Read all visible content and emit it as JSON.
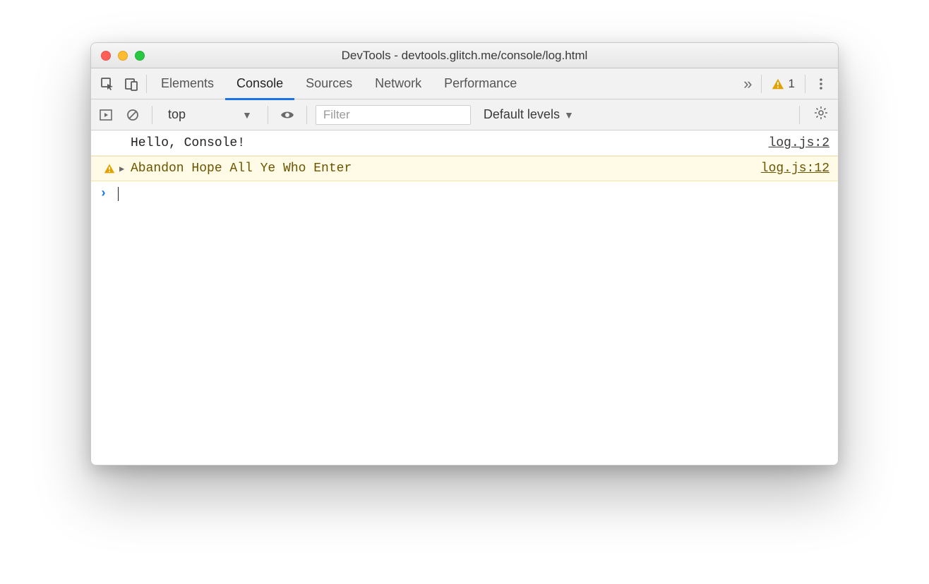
{
  "window": {
    "title": "DevTools - devtools.glitch.me/console/log.html"
  },
  "tabs": {
    "items": [
      "Elements",
      "Console",
      "Sources",
      "Network",
      "Performance"
    ],
    "active_index": 1,
    "overflow_glyph": "»",
    "warning_count": "1"
  },
  "toolbar": {
    "context_label": "top",
    "filter_placeholder": "Filter",
    "levels_label": "Default levels"
  },
  "console": {
    "rows": [
      {
        "kind": "log",
        "message": "Hello, Console!",
        "source": "log.js:2"
      },
      {
        "kind": "warn",
        "message": "Abandon Hope All Ye Who Enter",
        "source": "log.js:12"
      }
    ],
    "prompt_glyph": "›"
  }
}
